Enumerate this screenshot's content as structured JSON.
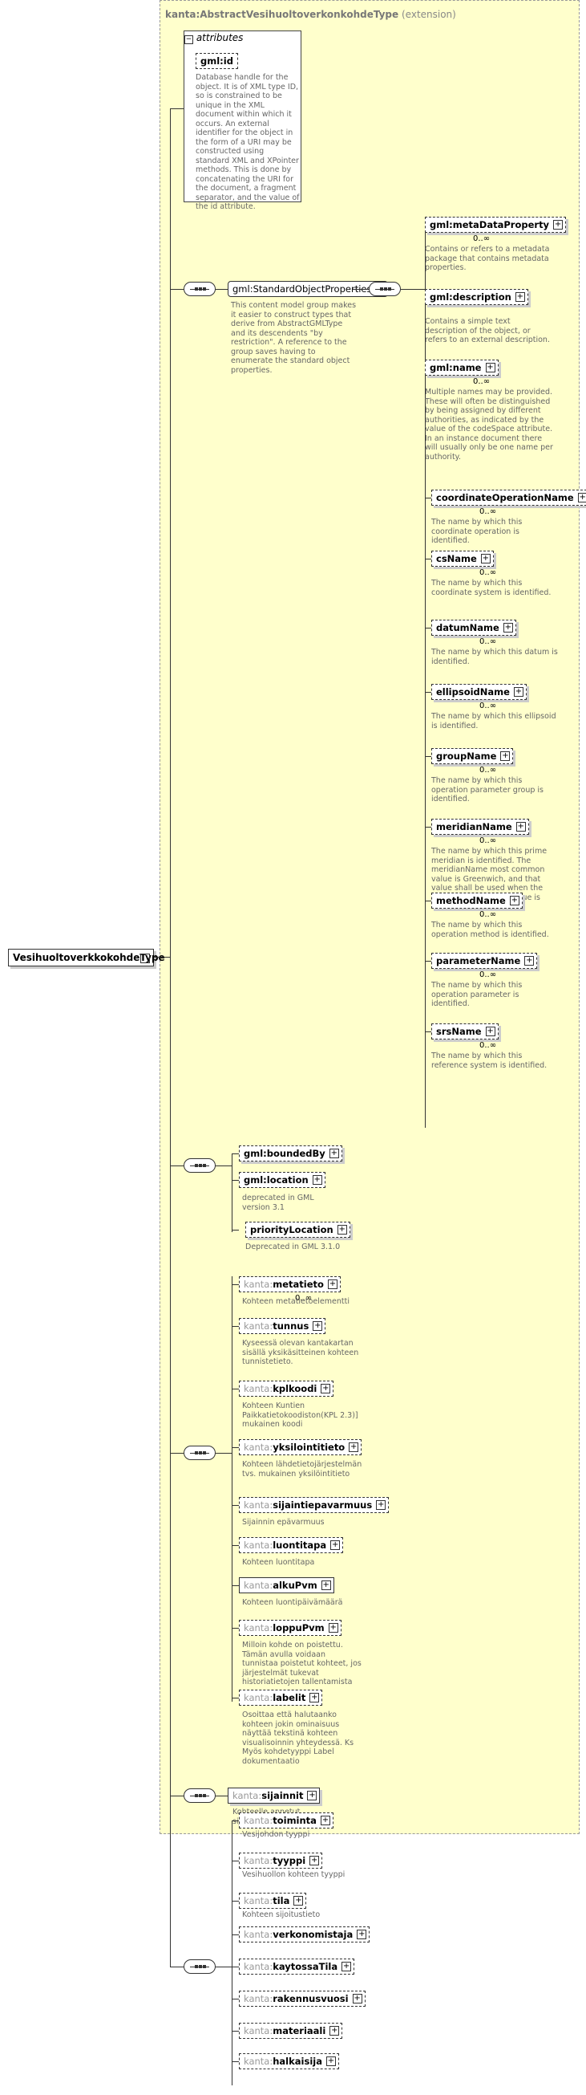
{
  "root": {
    "label": "VesihuoltoverkkokohdeType"
  },
  "extension": {
    "ns": "kanta:",
    "name": "AbstractVesihuoltoverkonkohdeType",
    "suffix": "(extension)"
  },
  "attributes": {
    "header": "attributes",
    "gmlid": {
      "label": "gml:id",
      "desc": "Database handle for the object.  It is of XML type ID, so is constrained to be unique in the XML document within which it occurs.  An external identifier for the object in the form of a URI may be constructed using standard XML and XPointer methods.  This is done by concatenating the URI for the document, a fragment separator, and the value of the id attribute."
    }
  },
  "standard_group": {
    "label": "gml:StandardObjectProperties",
    "desc": "This content model group makes it easier to construct types that derive from AbstractGMLType and its descendents \"by restriction\".  A reference to the group saves having to enumerate the standard object properties."
  },
  "gml_elements": [
    {
      "label": "gml:metaDataProperty",
      "card": "0..∞",
      "desc": "Contains or refers to a metadata package that contains metadata properties."
    },
    {
      "label": "gml:description",
      "card": "",
      "desc": "Contains a simple text description of the object, or refers to an external description."
    },
    {
      "label": "gml:name",
      "card": "0..∞",
      "desc": "Multiple names may be provided.  These will often be distinguished by being assigned by different authorities, as indicated by the value of the codeSpace attribute.  In an instance document there will usually only be one name per authority."
    },
    {
      "label": "coordinateOperationName",
      "card": "0..∞",
      "desc": "The name by which this coordinate operation is identified."
    },
    {
      "label": "csName",
      "card": "0..∞",
      "desc": "The name by which this coordinate system is identified."
    },
    {
      "label": "datumName",
      "card": "0..∞",
      "desc": "The name by which this datum is identified."
    },
    {
      "label": "ellipsoidName",
      "card": "0..∞",
      "desc": "The name by which this ellipsoid is identified."
    },
    {
      "label": "groupName",
      "card": "0..∞",
      "desc": "The name by which this operation parameter group is identified."
    },
    {
      "label": "meridianName",
      "card": "0..∞",
      "desc": "The name by which this prime meridian is identified. The meridianName most common value is Greenwich, and that value shall be used when the greenwichLongitude value is zero."
    },
    {
      "label": "methodName",
      "card": "0..∞",
      "desc": "The name by which this operation method is identified."
    },
    {
      "label": "parameterName",
      "card": "0..∞",
      "desc": "The name by which this operation parameter is identified."
    },
    {
      "label": "srsName",
      "card": "0..∞",
      "desc": "The name by which this reference system is identified."
    }
  ],
  "bounded": {
    "boundedBy": {
      "label": "gml:boundedBy"
    },
    "location": {
      "label": "gml:location",
      "desc": "deprecated in GML version 3.1"
    },
    "priority": {
      "label": "priorityLocation",
      "desc": "Deprecated in GML 3.1.0"
    }
  },
  "kanta_elements": [
    {
      "ns": "kanta:",
      "name": "metatieto",
      "card": "0..∞",
      "desc": "Kohteen metatietoelementti"
    },
    {
      "ns": "kanta:",
      "name": "tunnus",
      "card": "",
      "desc": "Kyseessä olevan kantakartan sisällä yksikäsitteinen kohteen tunnistetieto."
    },
    {
      "ns": "kanta:",
      "name": "kplkoodi",
      "card": "",
      "desc": "Kohteen Kuntien Paikkatietokoodiston(KPL 2.3)] mukainen koodi"
    },
    {
      "ns": "kanta:",
      "name": "yksilointitieto",
      "card": "",
      "desc": "Kohteen lähdetietojärjestelmän  tvs. mukainen yksilöintitieto"
    },
    {
      "ns": "kanta:",
      "name": "sijaintiepavarmuus",
      "card": "",
      "desc": "Sijainnin epävarmuus"
    },
    {
      "ns": "kanta:",
      "name": "luontitapa",
      "card": "",
      "desc": "Kohteen luontitapa"
    },
    {
      "ns": "kanta:",
      "name": "alkuPvm",
      "card": "",
      "desc": "Kohteen luontipäivämäärä"
    },
    {
      "ns": "kanta:",
      "name": "loppuPvm",
      "card": "",
      "desc": "Milloin kohde on poistettu. Tämän avulla voidaan tunnistaa poistetut kohteet, jos järjestelmät tukevat historiatietojen tallentamista"
    },
    {
      "ns": "kanta:",
      "name": "labelit",
      "card": "",
      "desc": "Osoittaa että halutaanko kohteen jokin ominaisuus näyttää tekstinä kohteen visualisoinnin yhteydessä. Ks Myös kohdetyyppi Label dokumentaatio"
    }
  ],
  "sijainnit": {
    "ns": "kanta:",
    "name": "sijainnit",
    "desc": "Kohteelle annetut sijaintiominaisuudet"
  },
  "bottom_elements": [
    {
      "ns": "kanta:",
      "name": "toiminta",
      "desc": "Vesijohdon tyyppi"
    },
    {
      "ns": "kanta:",
      "name": "tyyppi",
      "desc": "Vesihuollon kohteen tyyppi"
    },
    {
      "ns": "kanta:",
      "name": "tila",
      "desc": "Kohteen sijoitustieto"
    },
    {
      "ns": "kanta:",
      "name": "verkonomistaja",
      "desc": ""
    },
    {
      "ns": "kanta:",
      "name": "kaytossaTila",
      "desc": ""
    },
    {
      "ns": "kanta:",
      "name": "rakennusvuosi",
      "desc": ""
    },
    {
      "ns": "kanta:",
      "name": "materiaali",
      "desc": ""
    },
    {
      "ns": "kanta:",
      "name": "halkaisija",
      "desc": ""
    }
  ]
}
